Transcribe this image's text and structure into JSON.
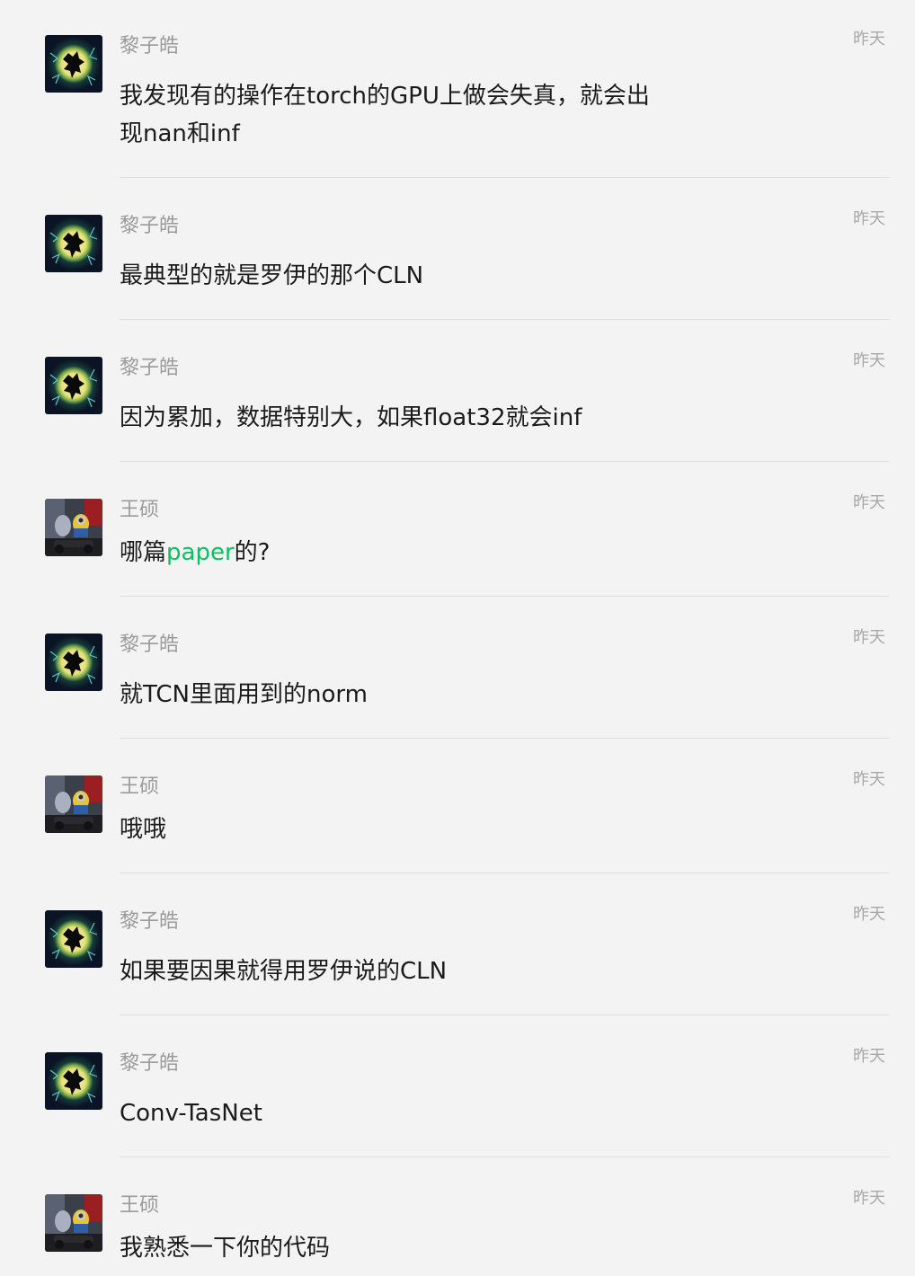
{
  "messages": [
    {
      "sender": "黎子皓",
      "avatar": "moon-avatar",
      "time": "昨天",
      "text": "我发现有的操作在torch的GPU上做会失真，就会出现nan和inf"
    },
    {
      "sender": "黎子皓",
      "avatar": "moon-avatar",
      "time": "昨天",
      "text": "最典型的就是罗伊的那个CLN"
    },
    {
      "sender": "黎子皓",
      "avatar": "moon-avatar",
      "time": "昨天",
      "text": "因为累加，数据特别大，如果float32就会inf"
    },
    {
      "sender": "王硕",
      "avatar": "minion-avatar",
      "time": "昨天",
      "text_before": "哪篇",
      "text_link": "paper",
      "text_after": "的?"
    },
    {
      "sender": "黎子皓",
      "avatar": "moon-avatar",
      "time": "昨天",
      "text": "就TCN里面用到的norm"
    },
    {
      "sender": "王硕",
      "avatar": "minion-avatar",
      "time": "昨天",
      "text": "哦哦"
    },
    {
      "sender": "黎子皓",
      "avatar": "moon-avatar",
      "time": "昨天",
      "text": "如果要因果就得用罗伊说的CLN"
    },
    {
      "sender": "黎子皓",
      "avatar": "moon-avatar",
      "time": "昨天",
      "text": "Conv-TasNet"
    },
    {
      "sender": "王硕",
      "avatar": "minion-avatar",
      "time": "昨天",
      "text": "我熟悉一下你的代码"
    }
  ],
  "colors": {
    "background": "#f3f3f3",
    "link": "#07c160",
    "sender": "#9b9b9b",
    "time": "#a8a8a8",
    "text": "#1b1b1b",
    "divider": "#dedede"
  }
}
